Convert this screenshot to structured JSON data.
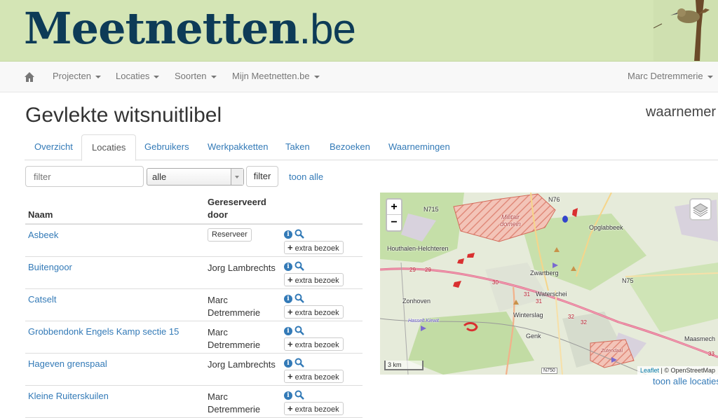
{
  "header": {
    "logo_bold": "Meetnetten",
    "logo_thin": ".be"
  },
  "nav": {
    "items": [
      {
        "label": "Projecten"
      },
      {
        "label": "Locaties"
      },
      {
        "label": "Soorten"
      },
      {
        "label": "Mijn Meetnetten.be"
      }
    ],
    "user": "Marc Detremmerie"
  },
  "page": {
    "title": "Gevlekte witsnuitlibel",
    "role": "waarnemer"
  },
  "tabs": [
    {
      "label": "Overzicht",
      "active": false
    },
    {
      "label": "Locaties",
      "active": true
    },
    {
      "label": "Gebruikers",
      "active": false
    },
    {
      "label": "Werkpakketten",
      "active": false
    },
    {
      "label": "Taken",
      "active": false
    },
    {
      "label": "Bezoeken",
      "active": false
    },
    {
      "label": "Waarnemingen",
      "active": false
    }
  ],
  "filter": {
    "placeholder": "filter",
    "select_value": "alle",
    "button": "filter",
    "show_all": "toon alle"
  },
  "table": {
    "col_name": "Naam",
    "col_reserved_line1": "Gereserveerd",
    "col_reserved_line2": "door",
    "reserve_label": "Reserveer",
    "extra_label": "extra bezoek",
    "rows": [
      {
        "name": "Asbeek",
        "reserved_by": ""
      },
      {
        "name": "Buitengoor",
        "reserved_by": "Jorg Lambrechts"
      },
      {
        "name": "Catselt",
        "reserved_by": "Marc Detremmerie"
      },
      {
        "name": "Grobbendonk Engels Kamp sectie 15",
        "reserved_by": "Marc Detremmerie"
      },
      {
        "name": "Hageven grenspaal",
        "reserved_by": "Jorg Lambrechts"
      },
      {
        "name": "Kleine Ruiterskuilen",
        "reserved_by": "Marc Detremmerie"
      }
    ]
  },
  "map": {
    "zoom_in": "+",
    "zoom_out": "−",
    "scale": "3 km",
    "attribution_link": "Leaflet",
    "attribution_text": " | © OpenStreetMap",
    "places": [
      "N715",
      "N76",
      "Militair domein",
      "Opglabbeek",
      "Houthalen-Helchteren",
      "Zwartberg",
      "Waterschei",
      "N75",
      "Zonhoven",
      "Winterslag",
      "Hasselt Kiewit",
      "Genk",
      "Zutendaal",
      "Maasmech",
      "N750",
      "29",
      "29",
      "30",
      "31",
      "31",
      "32",
      "32",
      "33"
    ],
    "show_all_locations": "toon alle locaties"
  }
}
